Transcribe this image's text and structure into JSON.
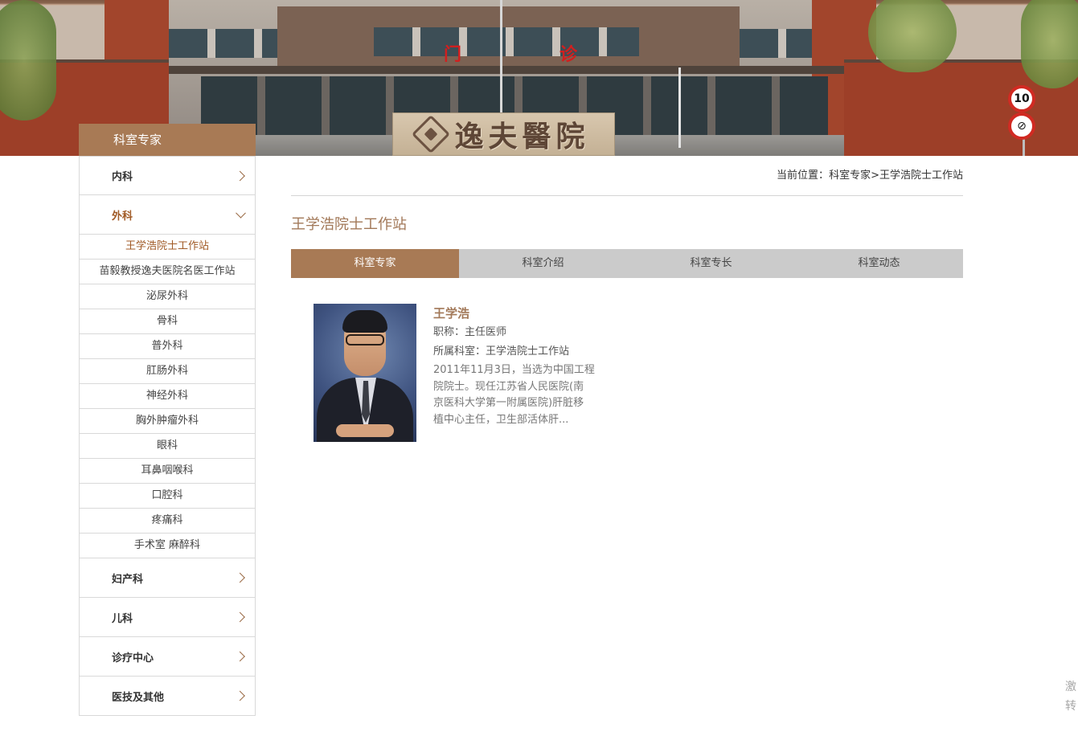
{
  "banner": {
    "hospital_sign": "逸夫醫院",
    "sign_left": "门",
    "sign_right": "诊",
    "speed_limit": "10",
    "no_horn_symbol": "⊘"
  },
  "sidebar": {
    "header": "科室专家",
    "categories_before": [
      {
        "label": "内科"
      }
    ],
    "active_category": {
      "label": "外科",
      "subitems": [
        {
          "label": "王学浩院士工作站"
        },
        {
          "label": "苗毅教授逸夫医院名医工作站"
        },
        {
          "label": "泌尿外科"
        },
        {
          "label": "骨科"
        },
        {
          "label": "普外科"
        },
        {
          "label": "肛肠外科"
        },
        {
          "label": "神经外科"
        },
        {
          "label": "胸外肿瘤外科"
        },
        {
          "label": "眼科"
        },
        {
          "label": "耳鼻咽喉科"
        },
        {
          "label": "口腔科"
        },
        {
          "label": "疼痛科"
        },
        {
          "label": "手术室 麻醉科"
        }
      ]
    },
    "categories_after": [
      {
        "label": "妇产科"
      },
      {
        "label": "儿科"
      },
      {
        "label": "诊疗中心"
      },
      {
        "label": "医技及其他"
      }
    ]
  },
  "breadcrumb": {
    "prefix": "当前位置：",
    "level1": "科室专家",
    "separator": ">",
    "level2": "王学浩院士工作站"
  },
  "page_title": "王学浩院士工作站",
  "tabs": [
    {
      "label": "科室专家"
    },
    {
      "label": "科室介绍"
    },
    {
      "label": "科室专长"
    },
    {
      "label": "科室动态"
    }
  ],
  "expert": {
    "name": "王学浩",
    "title_line": "职称：主任医师",
    "dept_line": "所属科室：王学浩院士工作站",
    "desc_lines": [
      "2011年11月3日，当选为中国工程",
      "院院士。现任江苏省人民医院(南",
      "京医科大学第一附属医院)肝脏移",
      "植中心主任，卫生部活体肝..."
    ]
  },
  "corner_note": {
    "line1": "激",
    "line2": "转"
  },
  "colors": {
    "accent": "#a87a55",
    "title_text": "#a27858",
    "tab_bg": "#cbcbcb",
    "active_category_text": "#a05a26"
  }
}
